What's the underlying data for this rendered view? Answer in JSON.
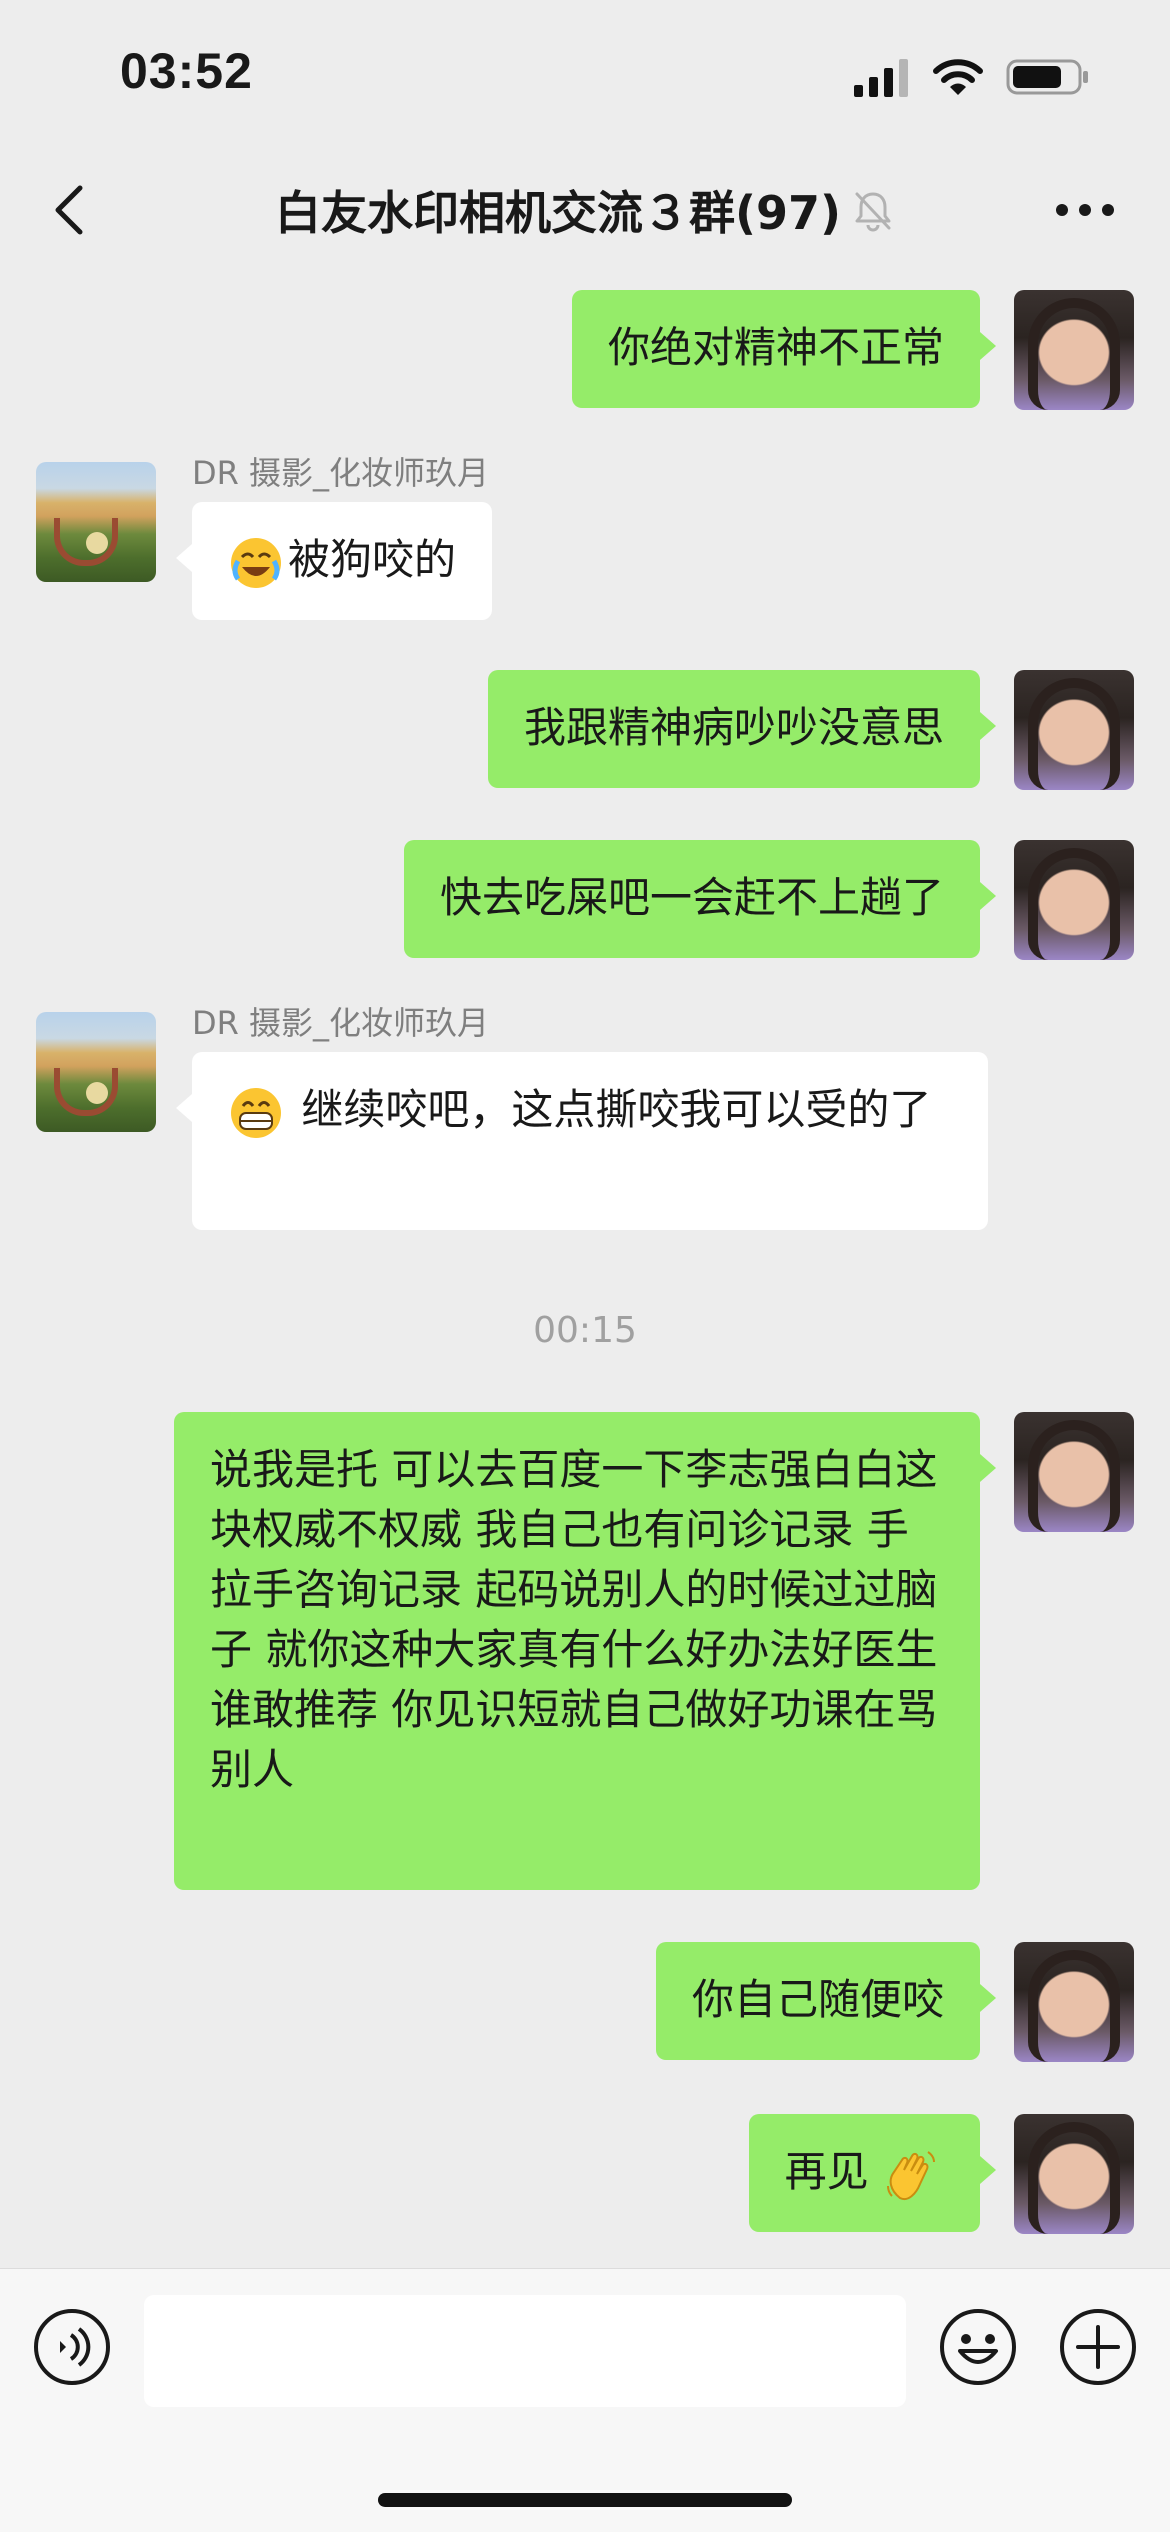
{
  "status_bar": {
    "time": "03:52"
  },
  "header": {
    "title": "白友水印相机交流３群(97)"
  },
  "messages": [
    {
      "sender": "me",
      "text": "你绝对精神不正常"
    },
    {
      "sender": "other",
      "name": "DR 摄影_化妆师玖月",
      "text": "被狗咬的",
      "emoji": "crying-laughing-emoji"
    },
    {
      "sender": "me",
      "text": "我跟精神病吵吵没意思"
    },
    {
      "sender": "me",
      "text": "快去吃屎吧一会赶不上趟了"
    },
    {
      "sender": "other",
      "name": "DR 摄影_化妆师玖月",
      "text": " 继续咬吧，这点撕咬我可以受的了",
      "emoji": "grinning-teeth-emoji"
    },
    {
      "sender": "me",
      "text": "说我是托 可以去百度一下李志强白白这块权威不权威 我自己也有问诊记录 手拉手咨询记录 起码说别人的时候过过脑子  就你这种大家真有什么好办法好医生谁敢推荐   你见识短就自己做好功课在骂别人"
    },
    {
      "sender": "me",
      "text": "你自己随便咬"
    },
    {
      "sender": "me",
      "text": "再见",
      "emoji": "waving-hand-emoji"
    }
  ],
  "timestamp": "00:15",
  "colors": {
    "bubble_me": "#95ec69",
    "bubble_other": "#ffffff",
    "background": "#ededed"
  },
  "icons": {
    "back": "chevron-left-icon",
    "mute": "bell-slash-icon",
    "more": "more-dots-icon",
    "voice": "voice-icon",
    "emoji": "smiley-icon",
    "plus": "plus-icon"
  }
}
